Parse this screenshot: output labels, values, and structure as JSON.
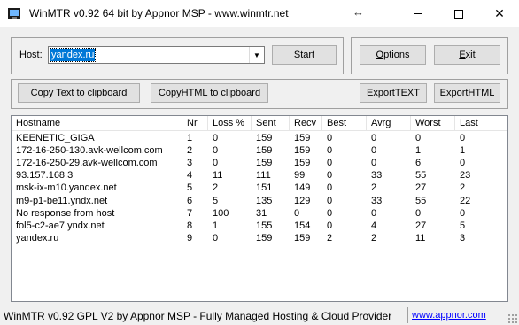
{
  "window": {
    "title": "WinMTR v0.92 64 bit by Appnor MSP - www.winmtr.net",
    "minimize_icon": "minimize-icon",
    "maximize_icon": "maximize-icon",
    "close_glyph": "✕",
    "resize_glyph": "↔"
  },
  "host_panel": {
    "label": "Host:",
    "value": "yandex.ru",
    "dropdown_glyph": "▼",
    "start_label": "Start"
  },
  "options_panel": {
    "options_label": "Options",
    "options_hotkey": "O",
    "exit_label": "Exit",
    "exit_hotkey": "E"
  },
  "export_panel": {
    "copy_text_label": "Copy Text to clipboard",
    "copy_html_label": "Copy HTML to clipboard",
    "export_text_label": "Export TEXT",
    "export_html_label": "Export HTML"
  },
  "table": {
    "columns": [
      "Hostname",
      "Nr",
      "Loss %",
      "Sent",
      "Recv",
      "Best",
      "Avrg",
      "Worst",
      "Last"
    ],
    "rows": [
      [
        "KEENETIC_GIGA",
        "1",
        "0",
        "159",
        "159",
        "0",
        "0",
        "0",
        "0"
      ],
      [
        "172-16-250-130.avk-wellcom.com",
        "2",
        "0",
        "159",
        "159",
        "0",
        "0",
        "1",
        "1"
      ],
      [
        "172-16-250-29.avk-wellcom.com",
        "3",
        "0",
        "159",
        "159",
        "0",
        "0",
        "6",
        "0"
      ],
      [
        "93.157.168.3",
        "4",
        "11",
        "111",
        "99",
        "0",
        "33",
        "55",
        "23"
      ],
      [
        "msk-ix-m10.yandex.net",
        "5",
        "2",
        "151",
        "149",
        "0",
        "2",
        "27",
        "2"
      ],
      [
        "m9-p1-be11.yndx.net",
        "6",
        "5",
        "135",
        "129",
        "0",
        "33",
        "55",
        "22"
      ],
      [
        "No response from host",
        "7",
        "100",
        "31",
        "0",
        "0",
        "0",
        "0",
        "0"
      ],
      [
        "fol5-c2-ae7.yndx.net",
        "8",
        "1",
        "155",
        "154",
        "0",
        "4",
        "27",
        "5"
      ],
      [
        "yandex.ru",
        "9",
        "0",
        "159",
        "159",
        "2",
        "2",
        "11",
        "3"
      ]
    ]
  },
  "status": {
    "text": "WinMTR v0.92 GPL V2 by Appnor MSP - Fully Managed Hosting & Cloud Provider",
    "link": "www.appnor.com"
  },
  "colors": {
    "selection": "#0078d7",
    "link": "#0000ff"
  }
}
